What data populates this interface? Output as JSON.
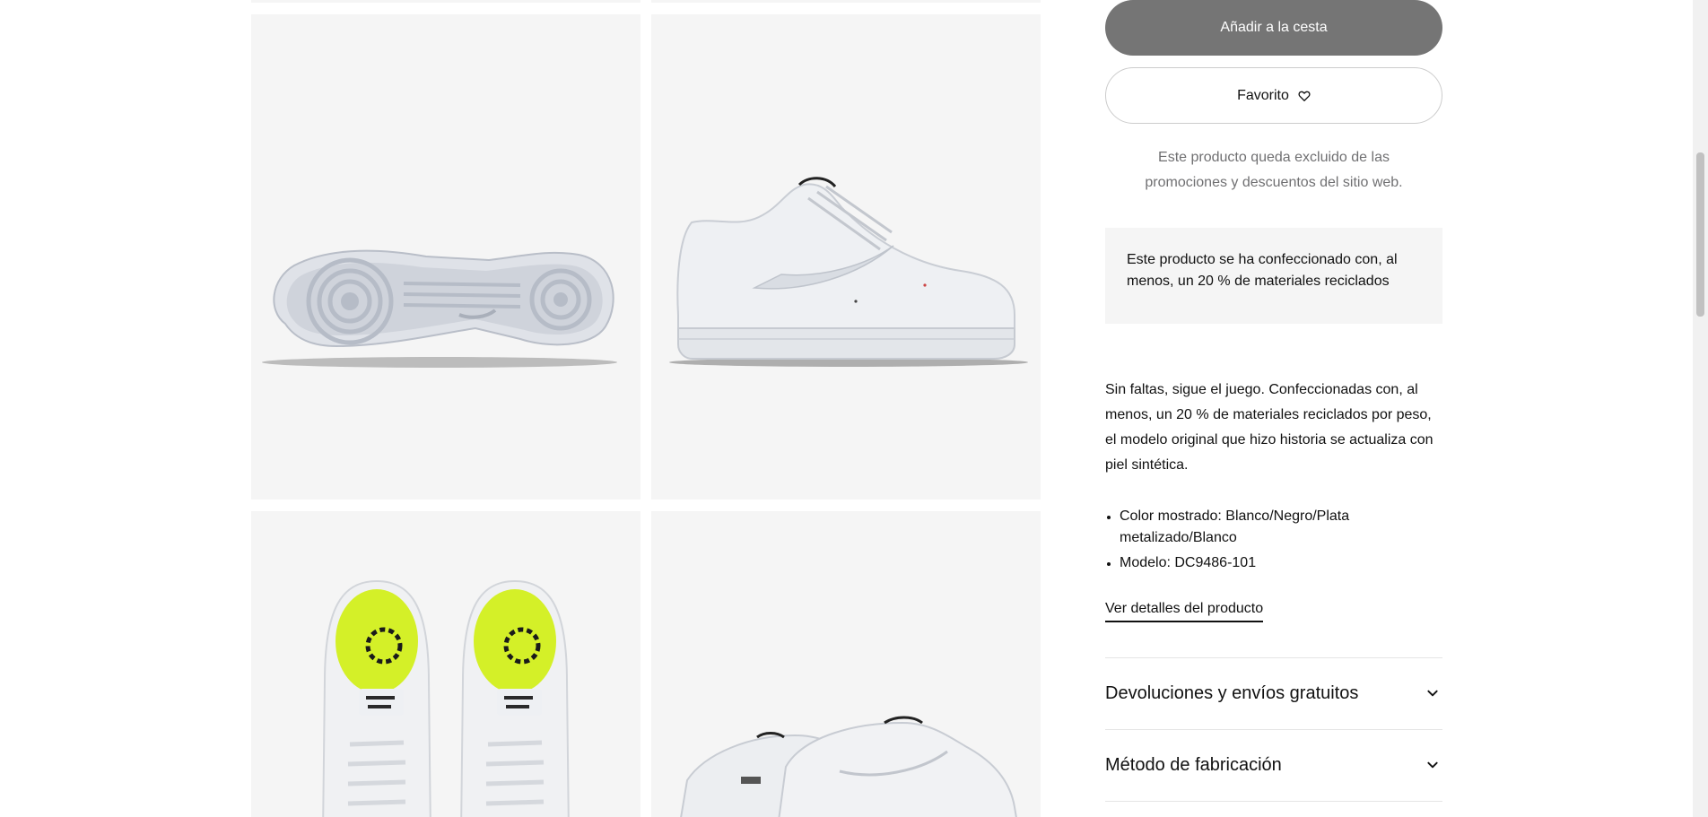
{
  "product_actions": {
    "add_to_cart_label": "Añadir a la cesta",
    "favorite_label": "Favorito"
  },
  "promo_notice": {
    "line1": "Este producto queda excluido de las",
    "line2": "promociones y descuentos del sitio web."
  },
  "recycled_notice": {
    "text": "Este producto se ha confeccionado con, al menos, un 20 % de materiales reciclados"
  },
  "description": {
    "text": "Sin faltas, sigue el juego. Confeccionadas con, al menos, un 20 % de materiales reciclados por peso, el modelo original que hizo historia se actualiza con piel sintética."
  },
  "specs": [
    "Color mostrado: Blanco/Negro/Plata metalizado/Blanco",
    "Modelo: DC9486-101"
  ],
  "details_link": "Ver detalles del producto",
  "accordions": [
    {
      "label": "Devoluciones y envíos gratuitos"
    },
    {
      "label": "Método de fabricación"
    }
  ],
  "colors": {
    "cart_button_bg": "#757575",
    "tile_bg": "#f5f5f5",
    "insole_accent": "#d4f028",
    "muted_text": "#707072"
  },
  "icons": {
    "favorite": "heart-outline-icon",
    "accordion": "chevron-down-icon"
  }
}
